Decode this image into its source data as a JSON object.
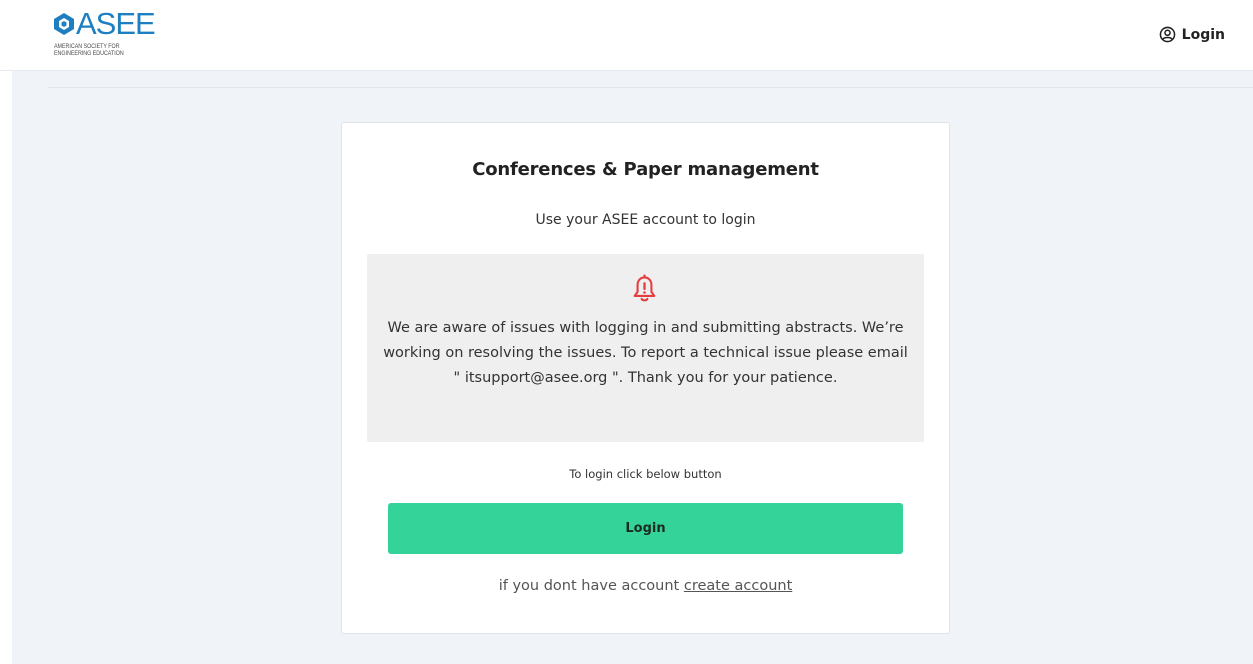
{
  "header": {
    "logo": {
      "wordmark": "ASEE",
      "line1": "AMERICAN SOCIETY FOR",
      "line2": "ENGINEERING EDUCATION",
      "icon": "asee-logo-icon"
    },
    "login_label": "Login",
    "login_icon": "user-circle-icon"
  },
  "card": {
    "title": "Conferences & Paper management",
    "subtitle": "Use your ASEE account to login",
    "notice": {
      "icon": "bell-alert-icon",
      "text": "We are aware of issues with logging in and submitting abstracts. We’re working on resolving the issues. To report a technical issue please email \" itsupport@asee.org \". Thank you for your patience."
    },
    "login_hint": "To login click below button",
    "login_button": "Login",
    "signup_prefix": "if you dont have account",
    "signup_link": "create account"
  },
  "colors": {
    "brand": "#1d7fc1",
    "accent_button": "#34d399",
    "alert_icon": "#e53e3e",
    "page_background": "#f0f3f7"
  }
}
